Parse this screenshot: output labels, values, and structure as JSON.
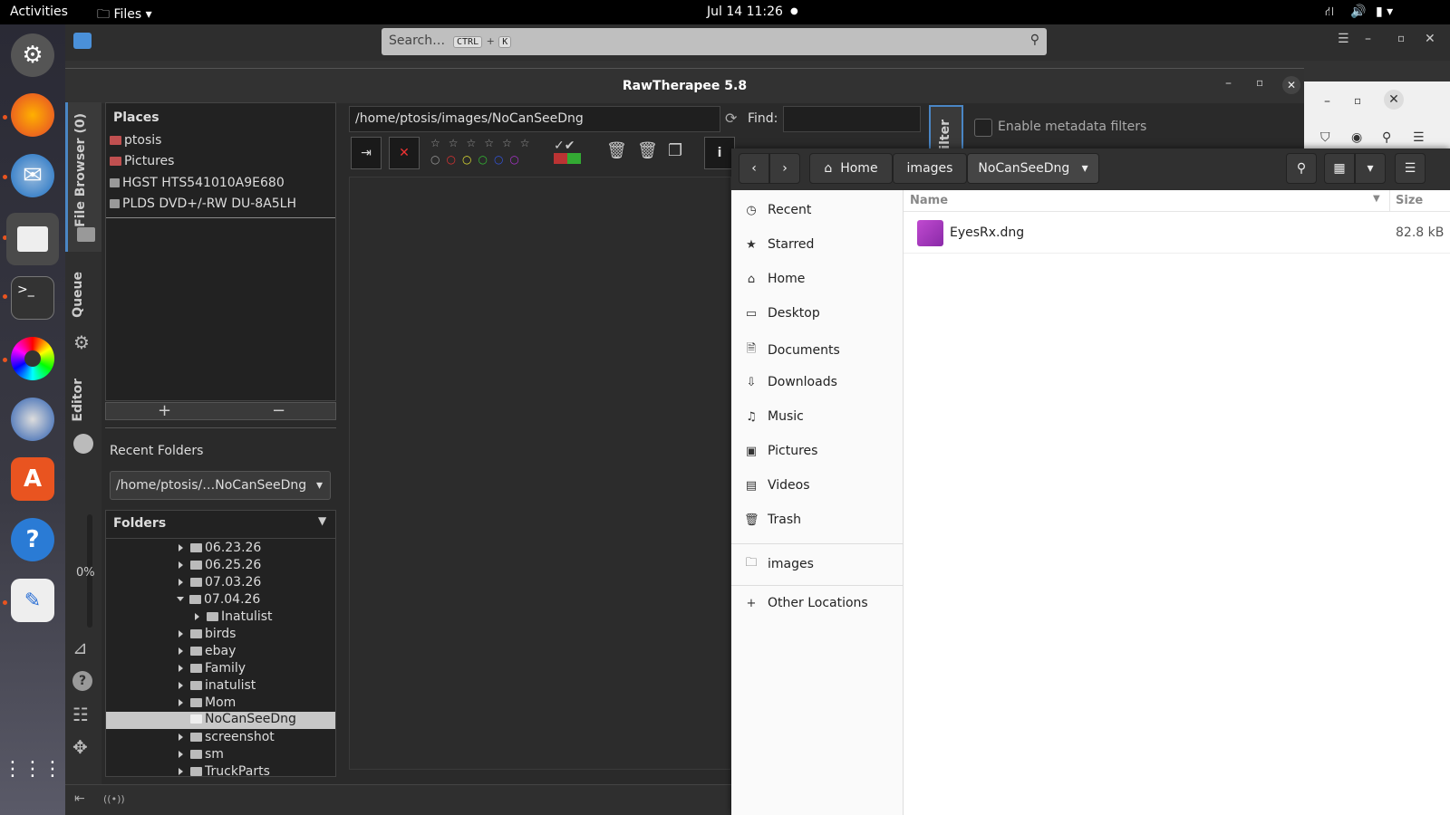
{
  "topbar": {
    "activities": "Activities",
    "app_menu": "Files",
    "clock": "Jul 14  11:26"
  },
  "dock": {
    "items": [
      "settings-icon",
      "firefox-icon",
      "thunderbird-icon",
      "files-icon",
      "terminal-icon",
      "color-icon",
      "rawtherapee-icon",
      "software-icon",
      "help-icon",
      "text-editor-icon",
      "app-grid-icon"
    ]
  },
  "bg": {
    "search_placeholder": "Search…",
    "kbd_ctrl": "CTRL",
    "kbd_plus": "+",
    "kbd_k": "K"
  },
  "rt": {
    "title": "RawTherapee 5.8",
    "tabs": {
      "file_browser": "File Browser (0)",
      "queue": "Queue",
      "editor": "Editor"
    },
    "progress": "0%",
    "places": {
      "header": "Places",
      "items": [
        "ptosis",
        "Pictures",
        "HGST HTS541010A9E680",
        "PLDS DVD+/-RW DU-8A5LH"
      ],
      "add": "+",
      "remove": "−"
    },
    "recent": {
      "header": "Recent Folders",
      "value": "/home/ptosis/…NoCanSeeDng"
    },
    "folders": {
      "header": "Folders",
      "items": [
        "06.23.26",
        "06.25.26",
        "07.03.26",
        "07.04.26",
        "Inatulist",
        "birds",
        "ebay",
        "Family",
        "inatulist",
        "Mom",
        "NoCanSeeDng",
        "screenshot",
        "sm",
        "TruckParts"
      ]
    },
    "path": "/home/ptosis/images/NoCanSeeDng",
    "find_label": "Find:",
    "filter_tab": "ilter",
    "metadata_filter": "Enable metadata filters"
  },
  "files": {
    "breadcrumb": [
      "Home",
      "images",
      "NoCanSeeDng"
    ],
    "sidebar": [
      {
        "icon": "clock-icon",
        "label": "Recent"
      },
      {
        "icon": "star-icon",
        "label": "Starred"
      },
      {
        "icon": "home-icon",
        "label": "Home"
      },
      {
        "icon": "desktop-icon",
        "label": "Desktop"
      },
      {
        "icon": "documents-icon",
        "label": "Documents"
      },
      {
        "icon": "downloads-icon",
        "label": "Downloads"
      },
      {
        "icon": "music-icon",
        "label": "Music"
      },
      {
        "icon": "pictures-icon",
        "label": "Pictures"
      },
      {
        "icon": "videos-icon",
        "label": "Videos"
      },
      {
        "icon": "trash-icon",
        "label": "Trash"
      }
    ],
    "bookmark": "images",
    "other_locations": "Other Locations",
    "columns": {
      "name": "Name",
      "size": "Size"
    },
    "rows": [
      {
        "name": "EyesRx.dng",
        "size": "82.8 kB"
      }
    ]
  }
}
